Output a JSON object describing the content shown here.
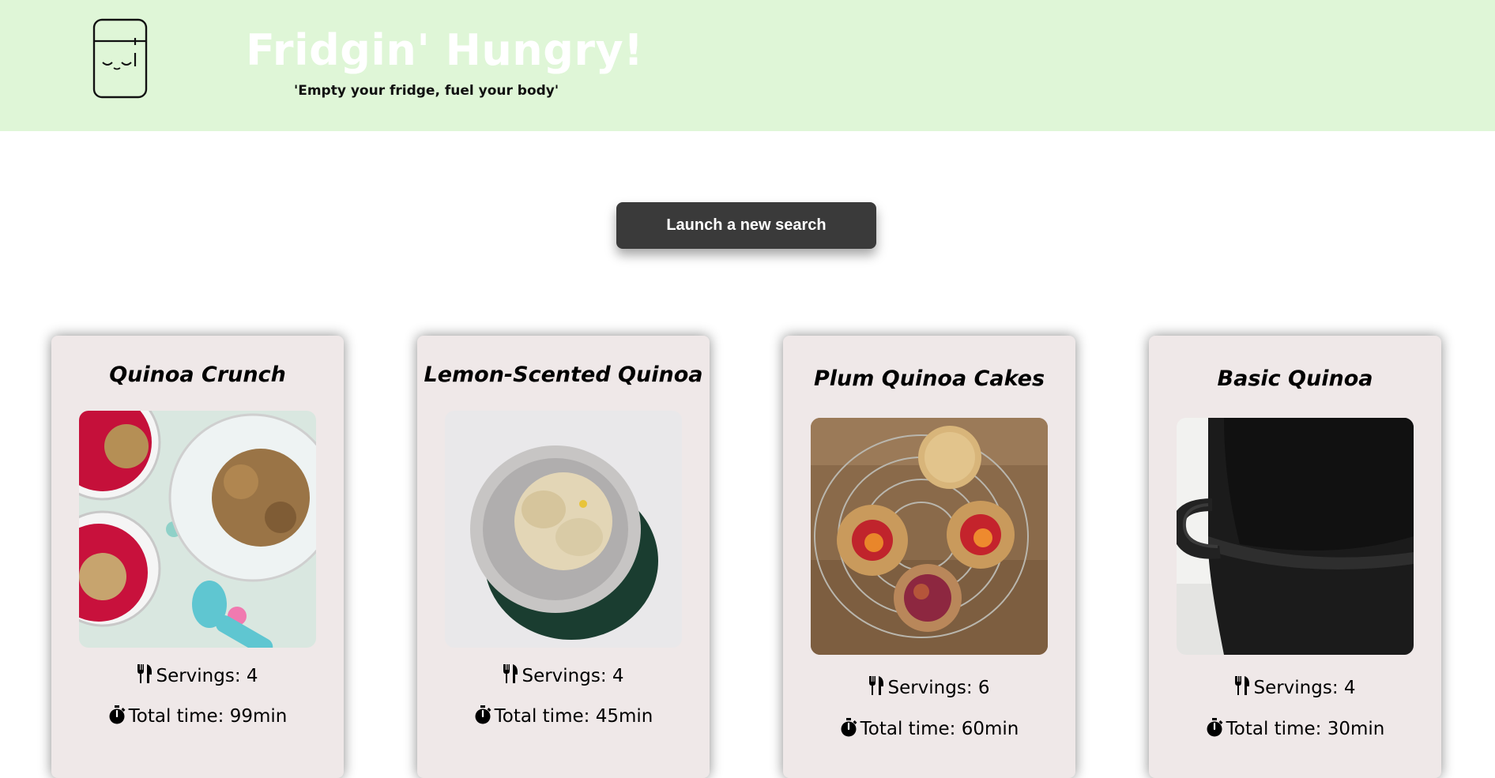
{
  "header": {
    "title": "Fridgin' Hungry!",
    "tagline": "'Empty your fridge, fuel your body'",
    "logo_icon": "fridge-face-icon",
    "background": "#dff6d7"
  },
  "search": {
    "button_label": "Launch a new search"
  },
  "recipes": [
    {
      "title": "Quinoa Crunch",
      "servings": "Servings: 4",
      "time": "Total time: 99min",
      "image": "quinoa-crunch-photo"
    },
    {
      "title": "Lemon-Scented Quinoa",
      "servings": "Servings: 4",
      "time": "Total time: 45min",
      "image": "lemon-quinoa-photo"
    },
    {
      "title": "Plum Quinoa Cakes",
      "servings": "Servings: 6",
      "time": "Total time: 60min",
      "image": "plum-cakes-photo"
    },
    {
      "title": "Basic Quinoa",
      "servings": "Servings: 4",
      "time": "Total time: 30min",
      "image": "cast-iron-pot-photo"
    }
  ],
  "icons": {
    "servings": "utensils-icon",
    "time": "stopwatch-icon"
  }
}
